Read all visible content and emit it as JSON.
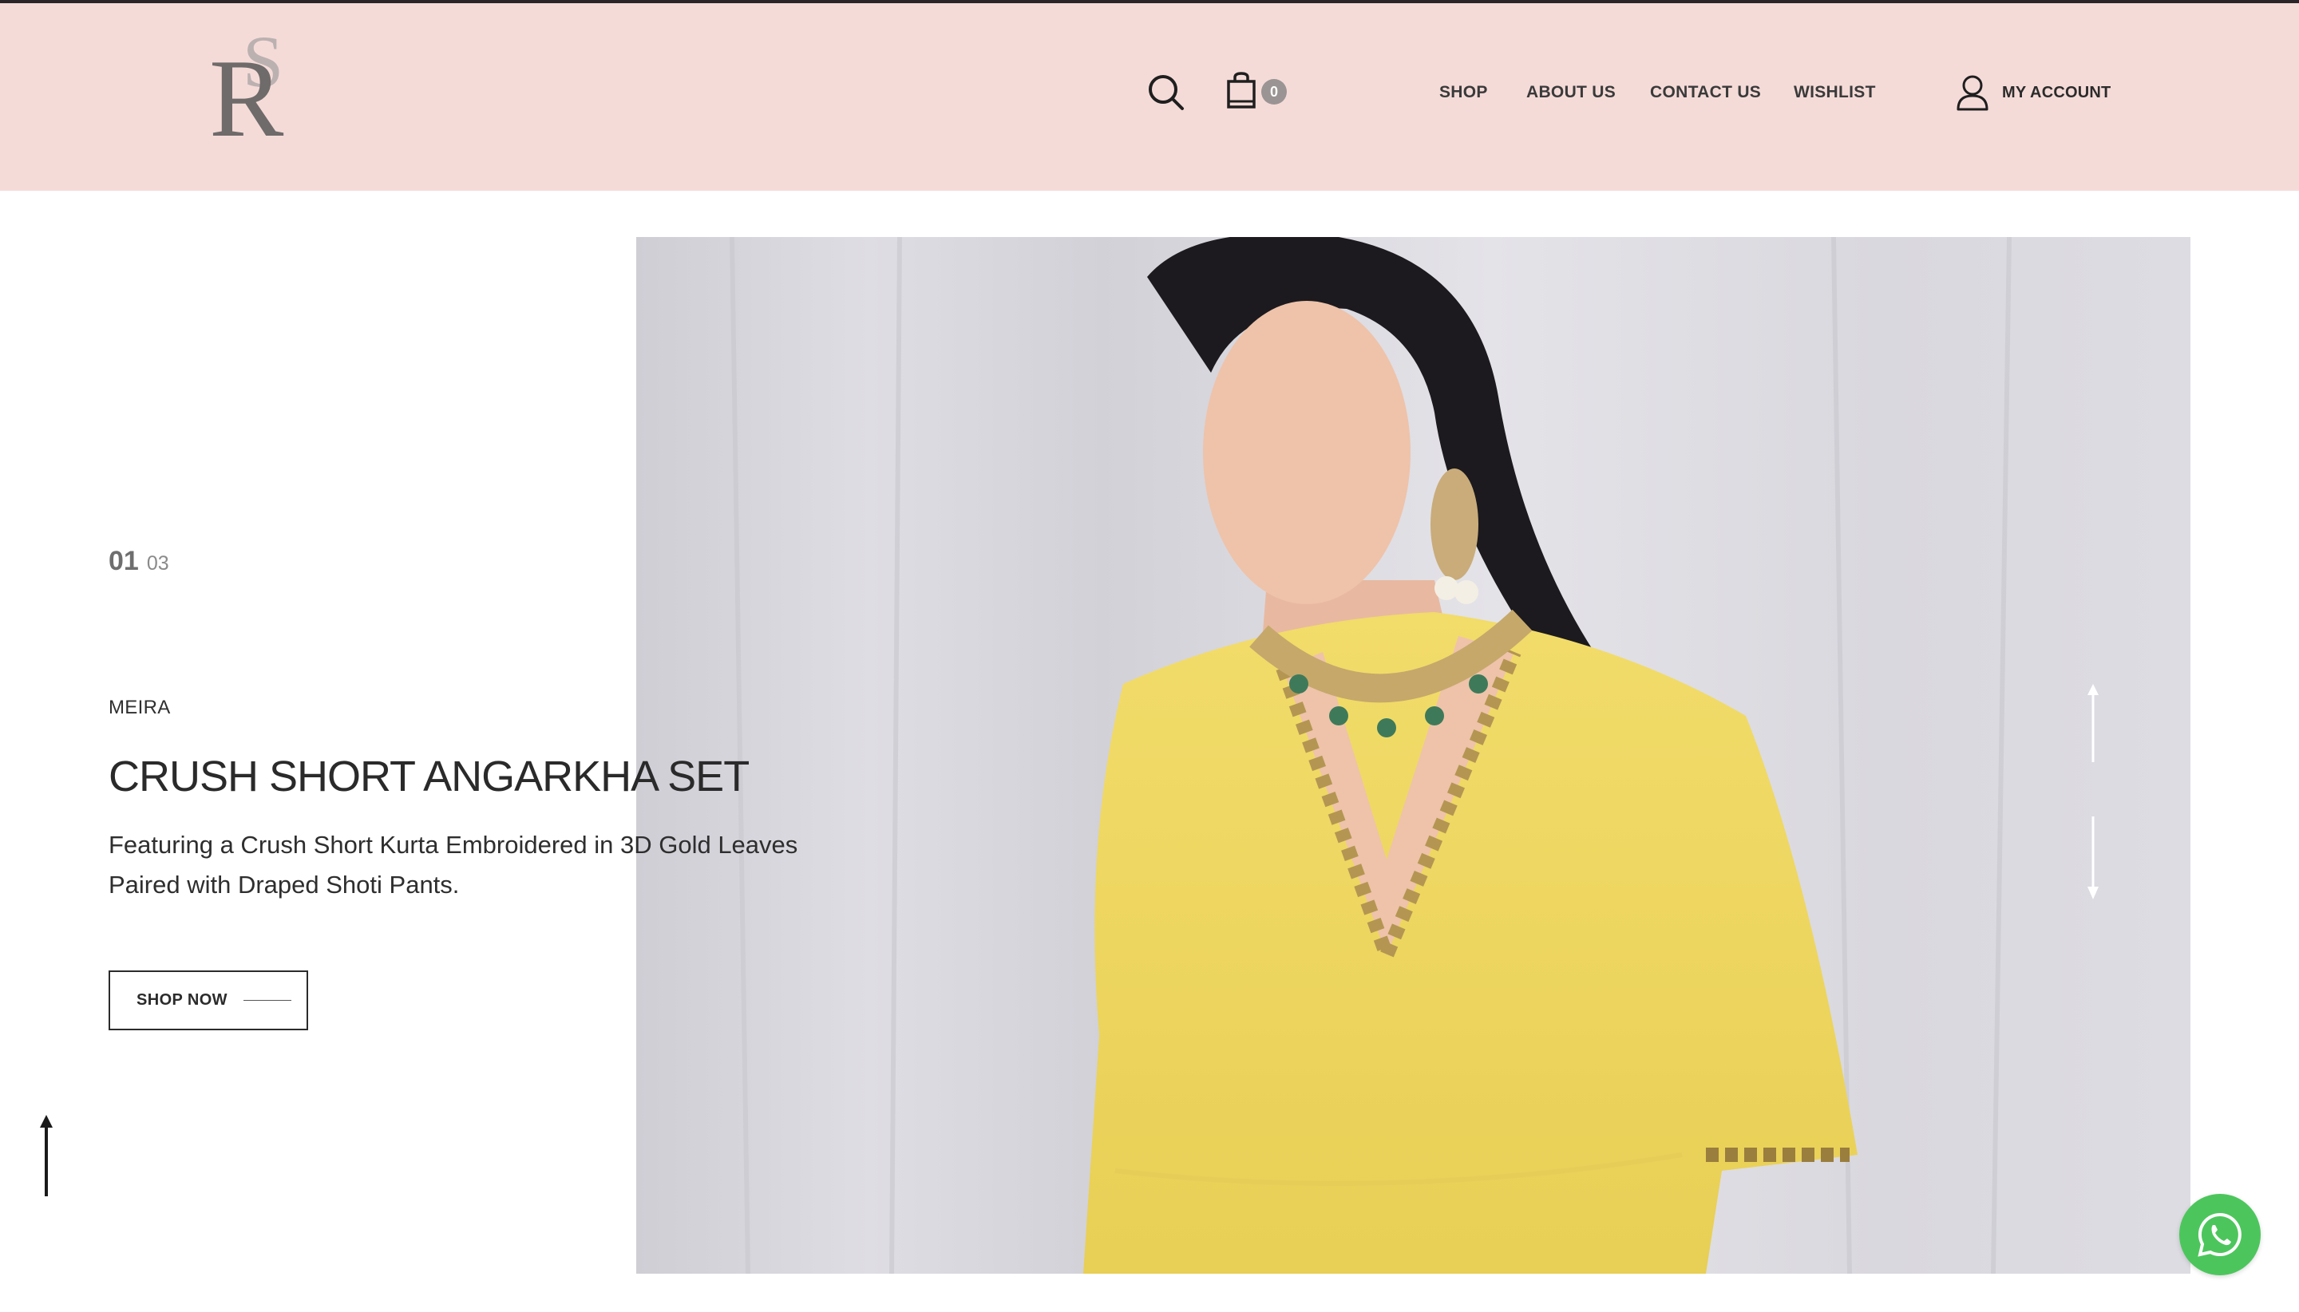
{
  "colors": {
    "header_bg": "#f5dbd8",
    "text_dark": "#2b2b2b",
    "badge_bg": "#9a9494",
    "whatsapp_green": "#4cc65c"
  },
  "header": {
    "logo_icon": "rs-monogram-logo",
    "search_icon": "search-icon",
    "cart_icon": "shopping-bag-icon",
    "cart_count": "0",
    "nav": [
      "SHOP",
      "ABOUT US",
      "CONTACT US",
      "WISHLIST"
    ],
    "account_icon": "user-icon",
    "account_label": "MY ACCOUNT"
  },
  "hero": {
    "slide_current": "01",
    "slide_total": "03",
    "brand": "MEIRA",
    "title": "CRUSH SHORT ANGARKHA SET",
    "description": "Featuring a Crush Short Kurta Embroidered in 3D Gold Leaves Paired with Draped Shoti Pants.",
    "cta_label": "SHOP NOW",
    "image": "model-in-yellow-angarkha-with-kundan-jewellery",
    "prev_arrow_icon": "arrow-up-icon",
    "next_arrow_icon": "arrow-down-icon"
  },
  "scroll_top_icon": "arrow-up-icon",
  "whatsapp_icon": "whatsapp-icon"
}
